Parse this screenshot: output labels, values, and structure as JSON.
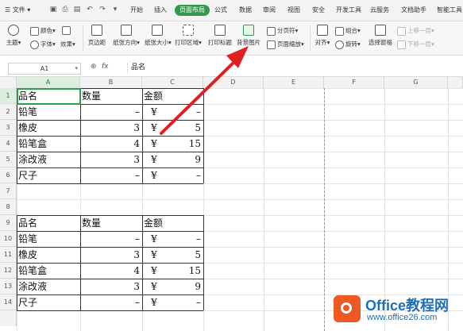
{
  "menubar": {
    "file_label": "文件",
    "items": [
      "开始",
      "插入",
      "页面布局",
      "公式",
      "数据",
      "审阅",
      "视图",
      "安全",
      "开发工具",
      "云服务",
      "文档助手",
      "智能工具"
    ],
    "active": "页面布局"
  },
  "ribbon": {
    "theme": "主题",
    "colors": "颜色",
    "fonts": "字体",
    "effects": "效果",
    "margins": "页边距",
    "orientation": "纸张方向",
    "size": "纸张大小",
    "print_area": "打印区域",
    "print_titles": "打印标题",
    "background": "背景图片",
    "page_break": "分页符",
    "page_zoom": "页面缩放",
    "align": "对齐",
    "group": "组合",
    "rotate": "旋转",
    "selection_pane": "选择窗格",
    "bring_forward": "上移一层",
    "send_backward": "下移一层"
  },
  "formula_bar": {
    "cell_ref": "A1",
    "fx": "fx",
    "content": "品名"
  },
  "columns": [
    "A",
    "B",
    "C",
    "D",
    "E",
    "F",
    "G"
  ],
  "rows": [
    "1",
    "2",
    "3",
    "4",
    "5",
    "6",
    "7",
    "8",
    "9",
    "10",
    "11",
    "12",
    "13",
    "14"
  ],
  "table1": {
    "headers": [
      "品名",
      "数量",
      "金额"
    ],
    "rows": [
      [
        "铅笔",
        "–",
        "¥",
        "–"
      ],
      [
        "橡皮",
        "3",
        "¥",
        "5"
      ],
      [
        "铅笔盒",
        "4",
        "¥",
        "15"
      ],
      [
        "涂改液",
        "3",
        "¥",
        "9"
      ],
      [
        "尺子",
        "–",
        "¥",
        "–"
      ]
    ]
  },
  "table2": {
    "headers": [
      "品名",
      "数量",
      "金额"
    ],
    "rows": [
      [
        "铅笔",
        "–",
        "¥",
        "–"
      ],
      [
        "橡皮",
        "3",
        "¥",
        "5"
      ],
      [
        "铅笔盒",
        "4",
        "¥",
        "15"
      ],
      [
        "涂改液",
        "3",
        "¥",
        "9"
      ],
      [
        "尺子",
        "–",
        "¥",
        "–"
      ]
    ]
  },
  "watermark": {
    "brand": "Office教程网",
    "url": "www.office26.com"
  },
  "colors": {
    "accent_green": "#2f9a4c",
    "arrow_red": "#e02020",
    "brand_blue": "#1f6fb2",
    "logo_orange": "#ee5a24"
  }
}
